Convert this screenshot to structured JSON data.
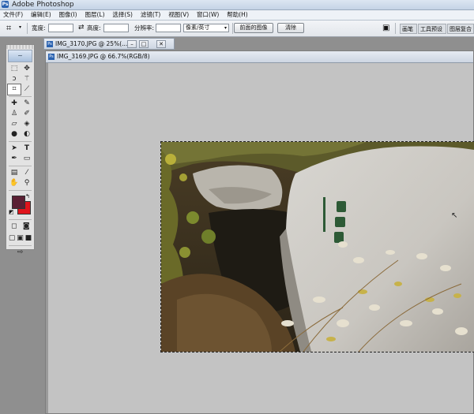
{
  "app": {
    "title": "Adobe Photoshop",
    "icon": "ps-icon"
  },
  "menu": [
    "文件(F)",
    "编辑(E)",
    "图像(I)",
    "图层(L)",
    "选择(S)",
    "滤镜(T)",
    "视图(V)",
    "窗口(W)",
    "帮助(H)"
  ],
  "options": {
    "width_label": "宽度:",
    "width_value": "",
    "height_label": "高度:",
    "height_value": "",
    "resolution_label": "分辨率:",
    "resolution_value": "",
    "unit_select": "像素/英寸",
    "front_image_button": "前面的图像",
    "clear_button": "清除",
    "wells": [
      "画笔",
      "工具预设",
      "图层复合"
    ]
  },
  "documents": [
    {
      "title": "IMG_3170.JPG @ 25%(...",
      "active": false
    },
    {
      "title": "IMG_3169.JPG @ 66.7%(RGB/8)",
      "active": true
    }
  ],
  "colors": {
    "foreground": "#5a1f33",
    "background": "#e0141c",
    "accent": "#2a62b0"
  },
  "tools": [
    "marquee-icon",
    "move-icon",
    "lasso-icon",
    "magic-wand-icon",
    "crop-icon",
    "slice-icon",
    "healing-brush-icon",
    "brush-icon",
    "clone-stamp-icon",
    "history-brush-icon",
    "eraser-icon",
    "paint-bucket-icon",
    "blur-icon",
    "dodge-icon",
    "path-select-icon",
    "type-icon",
    "pen-icon",
    "shape-icon",
    "notes-icon",
    "eyedropper-icon",
    "hand-icon",
    "zoom-icon"
  ]
}
